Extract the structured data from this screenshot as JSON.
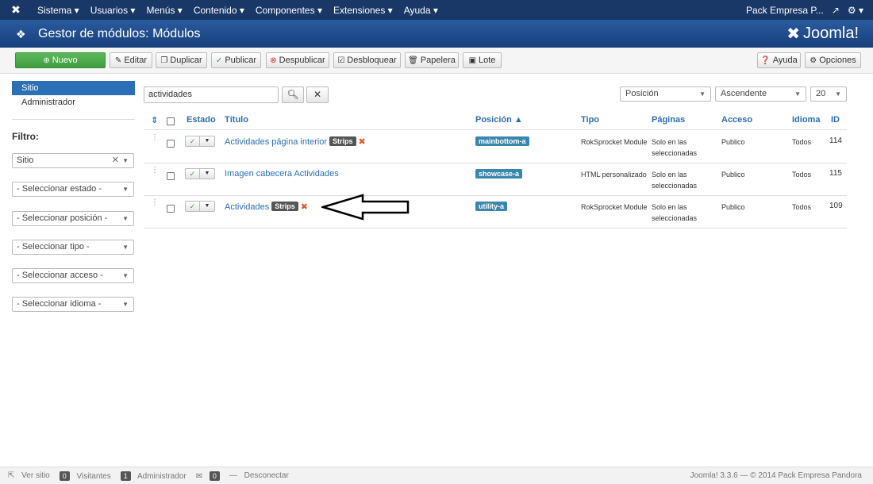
{
  "topnav": {
    "menu": [
      "Sistema ▾",
      "Usuarios ▾",
      "Menús ▾",
      "Contenido ▾",
      "Componentes ▾",
      "Extensiones ▾",
      "Ayuda ▾"
    ],
    "site_name": "Pack Empresa P...",
    "external_icon": "external-link-icon",
    "settings_icon": "gear-icon"
  },
  "titlebar": {
    "title": "Gestor de módulos: Módulos",
    "brand": "Joomla!"
  },
  "toolbar": {
    "nuevo": "Nuevo",
    "editar": "Editar",
    "duplicar": "Duplicar",
    "publicar": "Publicar",
    "despublicar": "Despublicar",
    "desbloquear": "Desbloquear",
    "papelera": "Papelera",
    "lote": "Lote",
    "ayuda": "Ayuda",
    "opciones": "Opciones"
  },
  "sidebar": {
    "items": [
      "Sitio",
      "Administrador"
    ],
    "filter_title": "Filtro:",
    "filters": [
      "Sitio",
      "- Seleccionar estado -",
      "- Seleccionar posición -",
      "- Seleccionar tipo -",
      "- Seleccionar acceso -",
      "- Seleccionar idioma -"
    ]
  },
  "search": {
    "value": "actividades"
  },
  "sort": {
    "field": "Posición",
    "direction": "Ascendente",
    "limit": "20"
  },
  "table": {
    "headers": {
      "estado": "Estado",
      "titulo": "Título",
      "posicion": "Posición ▲",
      "tipo": "Tipo",
      "paginas": "Páginas",
      "acceso": "Acceso",
      "idioma": "Idioma",
      "id": "ID"
    },
    "rows": [
      {
        "title": "Actividades página interior",
        "badge": "Strips",
        "position": "mainbottom-a",
        "type": "RokSprocket Module",
        "pages_1": "Solo en las",
        "pages_2": "seleccionadas",
        "access": "Publico",
        "language": "Todos",
        "id": "114"
      },
      {
        "title": "Imagen cabecera Actividades",
        "badge": "",
        "position": "showcase-a",
        "type": "HTML personalizado",
        "pages_1": "Solo en las",
        "pages_2": "seleccionadas",
        "access": "Publico",
        "language": "Todos",
        "id": "115"
      },
      {
        "title": "Actividades",
        "badge": "Strips",
        "position": "utility-a",
        "type": "RokSprocket Module",
        "pages_1": "Solo en las",
        "pages_2": "seleccionadas",
        "access": "Publico",
        "language": "Todos",
        "id": "109"
      }
    ]
  },
  "footer": {
    "ver_sitio": "Ver sitio",
    "visitantes_count": "0",
    "visitantes": "Visitantes",
    "admin_count": "1",
    "administrador": "Administrador",
    "mail_count": "0",
    "desconectar": "Desconectar",
    "version": "Joomla! 3.3.6 — © 2014 Pack Empresa Pandora"
  }
}
